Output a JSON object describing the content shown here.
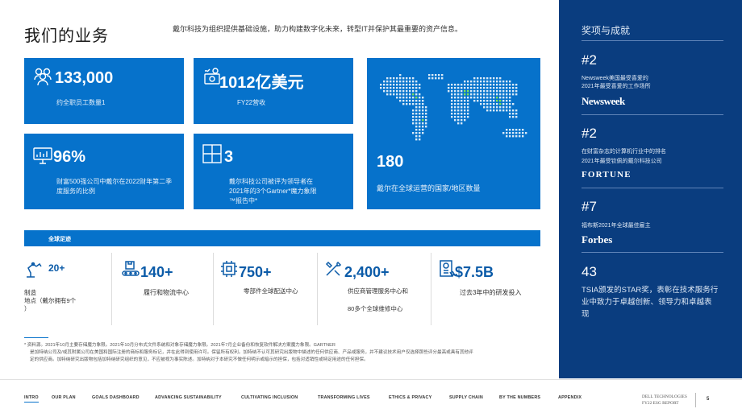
{
  "header": {
    "title": "我们的业务",
    "intro": "戴尔科技为组织提供基础设施，助力构建数字化未来，转型IT并保护其最重要的资产信息。"
  },
  "cards": [
    {
      "value": "133,000",
      "desc": "约全职员工数量1",
      "icon": "people-icon"
    },
    {
      "value": "1012亿美元",
      "desc": "FY22营收",
      "icon": "money-icon"
    },
    {
      "value": "96%",
      "desc": "财富500强公司中戴尔在2022财年第二季度服务的比例",
      "icon": "chart-monitor-icon"
    },
    {
      "value": "3",
      "desc": "戴尔科技公司被评为领导者在2021年的3个Gartner*魔力象限™报告中*",
      "icon": "grid-icon"
    },
    {
      "value": "180",
      "desc": "戴尔在全球运营的国家/地区数量",
      "icon": "world-map"
    }
  ],
  "strip": {
    "label": "全球足迹"
  },
  "stats": [
    {
      "value": "20+",
      "desc": "制造",
      "desc2": "地点（戴尔拥有9个",
      "desc3": "）",
      "icon": "robot-arm-icon"
    },
    {
      "value": "140+",
      "desc": "履行和物流中心",
      "desc2": "",
      "desc3": "",
      "icon": "conveyor-icon"
    },
    {
      "value": "750+",
      "desc": "零部件全球配送中心",
      "desc2": "",
      "desc3": "",
      "icon": "chip-icon"
    },
    {
      "value": "2,400+",
      "desc": "供应商管理服务中心和",
      "desc2": "",
      "desc3": "80多个全球维修中心",
      "icon": "tools-icon"
    },
    {
      "value": "$7.5B",
      "desc": "过去3年中的研发投入",
      "desc2": "",
      "desc3": "",
      "icon": "document-icon"
    }
  ],
  "footnote": {
    "line1": "* 资料源。2021年10月主要存储魔力象限。2021年10月分布式文件系统和对象存储魔力象限。2021年7月企业备份和恢复软件解决方案魔力象限。GARTNER",
    "line2": "是加特纳公司及/或其附属公司在美国和国际注册的商标和服务标记，并在此得到使用许可。保留所有权利。加特纳不认可其研究出版物中描述的任何供应商、产品或服务，并不建议技术用户仅选择那些评分最高或具有其他评",
    "line3": "定的供应商。加特纳研究出版物包括加特纳研究组织的意见，不应被视为事实陈述。加特纳对于本研究不做任何明示或暗示的担保，包括对适销性或特定用途的任何担保。"
  },
  "nav": {
    "items": [
      "INTRO",
      "OUR PLAN",
      "GOALS DASHBOARD",
      "ADVANCING SUSTAINABILITY",
      "CULTIVATING INCLUSION",
      "TRANSFORMING LIVES",
      "ETHICS & PRIVACY",
      "SUPPLY CHAIN",
      "BY THE NUMBERS",
      "APPENDIX"
    ],
    "brand1": "DELL TECHNOLOGIES",
    "brand2": "FY22 ESG REPORT",
    "page": "5"
  },
  "sidebar": {
    "title": "奖项与成就",
    "awards": [
      {
        "rank": "#2",
        "text1": "Newsweek美国最受喜爱的",
        "text2": "2021年最受喜爱的工作场所",
        "logo": "Newsweek"
      },
      {
        "rank": "#2",
        "text1": "在财富杂志的计算机行业中的排名",
        "text2": "2021年最受钦佩的戴尔科技公司",
        "logo": "FORTUNE"
      },
      {
        "rank": "#7",
        "text1": "福布斯2021年全球最佳雇主",
        "text2": "",
        "logo": "Forbes"
      },
      {
        "rank": "43",
        "text1": "TSIA颁发的STAR奖，表彰在技术服务行业中致力于卓越创新、领导力和卓越表现",
        "text2": "",
        "logo": ""
      }
    ]
  },
  "colors": {
    "primary_blue": "#0672cb",
    "sidebar_navy": "#0a3d7f",
    "stat_blue": "#0b5ba8"
  }
}
